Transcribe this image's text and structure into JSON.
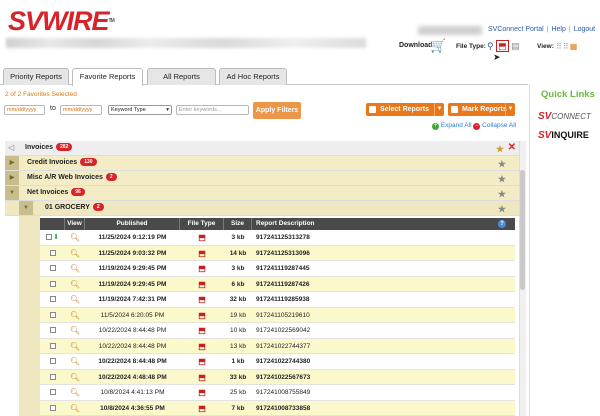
{
  "header": {
    "logo": "SVWIRE",
    "logo_tm": "TM",
    "links": [
      "SVConnect Portal",
      "Help",
      "Logout"
    ],
    "download_label": "Download",
    "file_type_label": "File Type:",
    "view_label": "View:"
  },
  "tabs": [
    {
      "label": "Priority Reports",
      "active": false
    },
    {
      "label": "Favorite Reports",
      "active": true
    },
    {
      "label": "All Reports",
      "active": false
    },
    {
      "label": "Ad Hoc Reports",
      "active": false
    }
  ],
  "favorites_selected": "2 of 2 Favorites Selected",
  "filters": {
    "from_placeholder": "mm/dd/yyyy",
    "to_label": "to",
    "to_placeholder": "mm/dd/yyyy",
    "keyword_type": "Keyword Type",
    "keywords_placeholder": "Enter keywords...",
    "apply_label": "Apply Filters",
    "select_reports": "Select Reports",
    "mark_reports": "Mark Reports",
    "expand_all": "Expand All",
    "collapse_all": "Collapse All"
  },
  "tree": {
    "root": {
      "label": "Invoices",
      "count": "282"
    },
    "items": [
      {
        "label": "Credit Invoices",
        "count": "130"
      },
      {
        "label": "Misc A/R Web Invoices",
        "count": "2"
      },
      {
        "label": "Net Invoices",
        "count": "96"
      }
    ],
    "sub": {
      "label": "01 GROCERY",
      "count": "2"
    }
  },
  "table": {
    "headers": [
      "View",
      "Published",
      "File Type",
      "Size",
      "Report Description"
    ],
    "rows": [
      {
        "published": "11/25/2024 9:12:19 PM",
        "size": "3 kb",
        "desc": "917241125313278",
        "bold": true,
        "alt": false,
        "downloaded": true
      },
      {
        "published": "11/25/2024 9:03:32 PM",
        "size": "14 kb",
        "desc": "917241125313096",
        "bold": true,
        "alt": true,
        "downloaded": false
      },
      {
        "published": "11/19/2024 9:29:45 PM",
        "size": "3 kb",
        "desc": "917241119287445",
        "bold": true,
        "alt": false,
        "downloaded": false
      },
      {
        "published": "11/19/2024 9:29:45 PM",
        "size": "6 kb",
        "desc": "917241119287426",
        "bold": true,
        "alt": true,
        "downloaded": false
      },
      {
        "published": "11/19/2024 7:42:31 PM",
        "size": "32 kb",
        "desc": "917241119285938",
        "bold": true,
        "alt": false,
        "downloaded": false
      },
      {
        "published": "11/5/2024 6:20:05 PM",
        "size": "19 kb",
        "desc": "917241105219610",
        "bold": false,
        "alt": true,
        "downloaded": false
      },
      {
        "published": "10/22/2024 8:44:48 PM",
        "size": "10 kb",
        "desc": "917241022569042",
        "bold": false,
        "alt": false,
        "downloaded": false
      },
      {
        "published": "10/22/2024 8:44:48 PM",
        "size": "13 kb",
        "desc": "917241022744377",
        "bold": false,
        "alt": true,
        "downloaded": false
      },
      {
        "published": "10/22/2024 8:44:48 PM",
        "size": "1 kb",
        "desc": "917241022744380",
        "bold": true,
        "alt": false,
        "downloaded": false
      },
      {
        "published": "10/22/2024 4:48:48 PM",
        "size": "33 kb",
        "desc": "917241022567673",
        "bold": true,
        "alt": true,
        "downloaded": false
      },
      {
        "published": "10/8/2024 4:41:13 PM",
        "size": "25 kb",
        "desc": "917241008755849",
        "bold": false,
        "alt": false,
        "downloaded": false
      },
      {
        "published": "10/8/2024 4:36:55 PM",
        "size": "7 kb",
        "desc": "917241008733858",
        "bold": true,
        "alt": true,
        "downloaded": false
      }
    ]
  },
  "quick_links": {
    "title": "Quick Links",
    "svconnect": {
      "mark": "SV",
      "text": "CONNECT"
    },
    "svinquire": {
      "mark": "SV",
      "text": "INQUIRE"
    }
  },
  "colors": {
    "brand_red": "#d8232a",
    "orange": "#e8781a",
    "quick_links_green": "#6bbb3a",
    "row_alt": "#fbf8cc"
  }
}
